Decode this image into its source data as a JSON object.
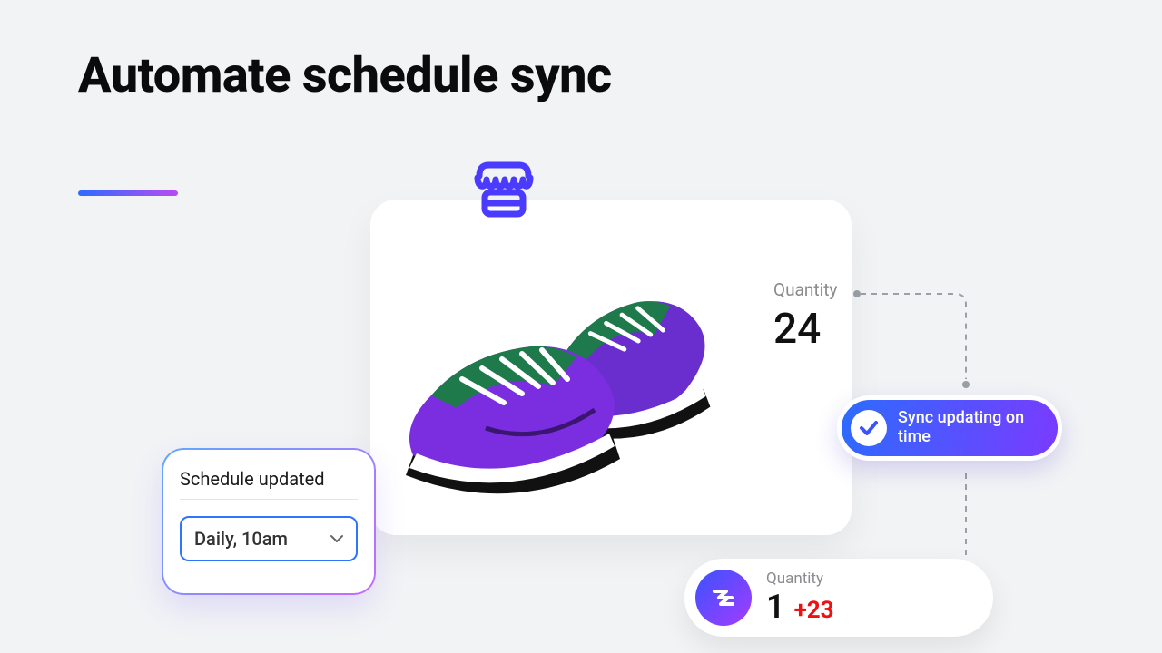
{
  "headline": "Automate schedule sync",
  "product": {
    "quantity_label": "Quantity",
    "quantity_value": "24"
  },
  "schedule": {
    "title": "Schedule updated",
    "selected": "Daily, 10am"
  },
  "status": {
    "text": "Sync updating on time"
  },
  "sync_result": {
    "quantity_label": "Quantity",
    "quantity_value": "1",
    "delta": "+23"
  }
}
